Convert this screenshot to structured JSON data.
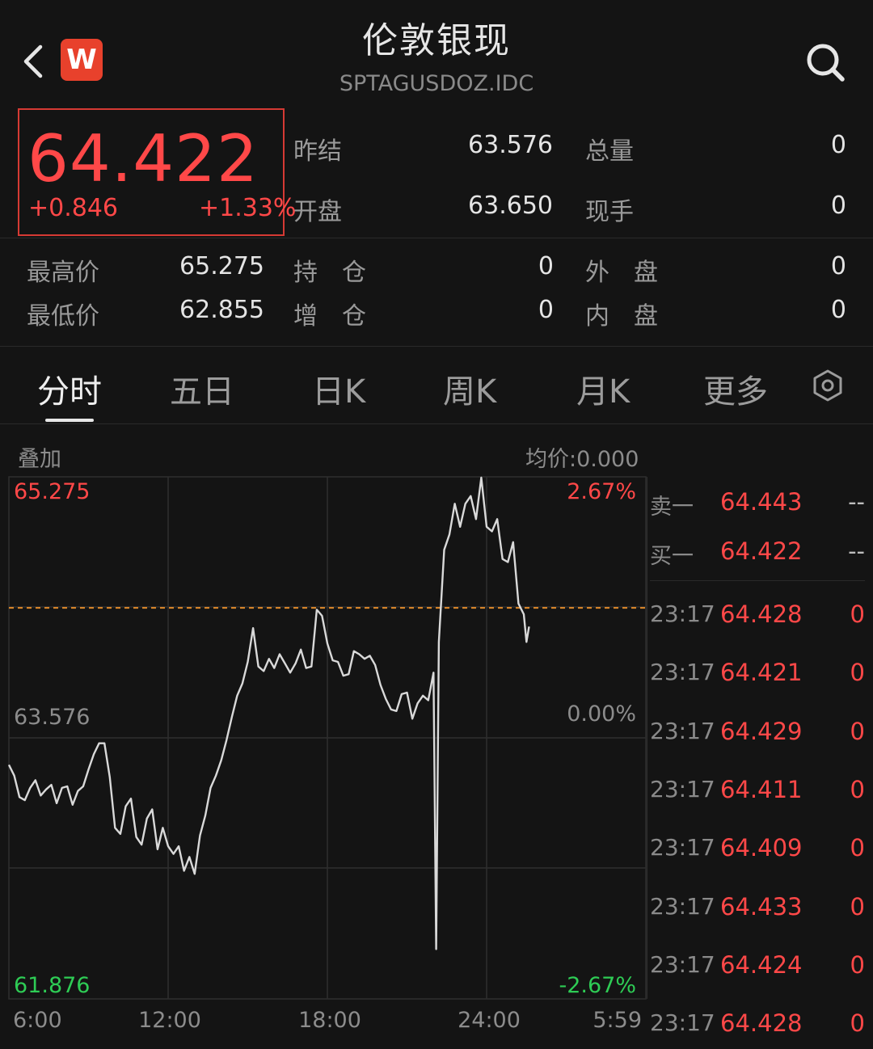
{
  "header": {
    "title": "伦敦银现",
    "code": "SPTAGUSDOZ.IDC",
    "logo_letter": "W"
  },
  "quote": {
    "price": "64.422",
    "change": "+0.846",
    "change_pct": "+1.33%"
  },
  "stats": {
    "prev_settle_label": "昨结",
    "prev_settle": "63.576",
    "total_vol_label": "总量",
    "total_vol": "0",
    "open_label": "开盘",
    "open": "63.650",
    "cur_hand_label": "现手",
    "cur_hand": "0",
    "high_label": "最高价",
    "high": "65.275",
    "hold_label": "持　仓",
    "hold": "0",
    "outer_label": "外　盘",
    "outer": "0",
    "low_label": "最低价",
    "low": "62.855",
    "add_label": "增　仓",
    "add": "0",
    "inner_label": "内　盘",
    "inner": "0"
  },
  "tabs": [
    {
      "label": "分时",
      "active": true
    },
    {
      "label": "五日",
      "active": false
    },
    {
      "label": "日K",
      "active": false
    },
    {
      "label": "周K",
      "active": false
    },
    {
      "label": "月K",
      "active": false
    },
    {
      "label": "更多",
      "active": false
    }
  ],
  "chart_header": {
    "overlay_label": "叠加",
    "avg_price_label": "均价:0.000"
  },
  "chart_data": {
    "type": "line",
    "ylim": [
      61.876,
      65.275
    ],
    "y_left_labels": [
      "65.275",
      "63.576",
      "61.876"
    ],
    "y_right_labels": [
      "2.67%",
      "0.00%",
      "-2.67%"
    ],
    "x_labels": [
      "6:00",
      "12:00",
      "18:00",
      "24:00",
      "5:59"
    ],
    "reference_value": 63.576,
    "current_value": 64.422,
    "colors": {
      "line": "#d9d9d9",
      "up": "#ff4848",
      "down": "#2ecc55",
      "reference": "#e08a2a"
    },
    "points": [
      [
        0,
        63.4
      ],
      [
        2,
        63.33
      ],
      [
        4,
        63.19
      ],
      [
        6,
        63.17
      ],
      [
        8,
        63.25
      ],
      [
        10,
        63.3
      ],
      [
        12,
        63.2
      ],
      [
        14,
        63.24
      ],
      [
        16,
        63.27
      ],
      [
        18,
        63.15
      ],
      [
        20,
        63.25
      ],
      [
        22,
        63.26
      ],
      [
        24,
        63.14
      ],
      [
        26,
        63.23
      ],
      [
        28,
        63.26
      ],
      [
        30,
        63.37
      ],
      [
        32,
        63.47
      ],
      [
        34,
        63.54
      ],
      [
        36,
        63.54
      ],
      [
        38,
        63.32
      ],
      [
        40,
        62.99
      ],
      [
        42,
        62.95
      ],
      [
        44,
        63.13
      ],
      [
        46,
        63.18
      ],
      [
        48,
        62.93
      ],
      [
        50,
        62.88
      ],
      [
        52,
        63.05
      ],
      [
        54,
        63.11
      ],
      [
        56,
        62.85
      ],
      [
        58,
        62.99
      ],
      [
        60,
        62.87
      ],
      [
        62,
        62.82
      ],
      [
        64,
        62.87
      ],
      [
        66,
        62.71
      ],
      [
        68,
        62.8
      ],
      [
        70,
        62.69
      ],
      [
        72,
        62.94
      ],
      [
        74,
        63.07
      ],
      [
        76,
        63.25
      ],
      [
        78,
        63.33
      ],
      [
        80,
        63.43
      ],
      [
        82,
        63.56
      ],
      [
        84,
        63.71
      ],
      [
        86,
        63.85
      ],
      [
        88,
        63.93
      ],
      [
        90,
        64.07
      ],
      [
        92,
        64.29
      ],
      [
        94,
        64.04
      ],
      [
        96,
        64.01
      ],
      [
        98,
        64.09
      ],
      [
        100,
        64.03
      ],
      [
        102,
        64.12
      ],
      [
        104,
        64.06
      ],
      [
        106,
        64.0
      ],
      [
        108,
        64.06
      ],
      [
        110,
        64.15
      ],
      [
        112,
        64.03
      ],
      [
        114,
        64.04
      ],
      [
        116,
        64.41
      ],
      [
        118,
        64.37
      ],
      [
        120,
        64.19
      ],
      [
        122,
        64.08
      ],
      [
        124,
        64.07
      ],
      [
        126,
        63.98
      ],
      [
        128,
        63.99
      ],
      [
        130,
        64.14
      ],
      [
        132,
        64.12
      ],
      [
        134,
        64.09
      ],
      [
        136,
        64.11
      ],
      [
        138,
        64.05
      ],
      [
        140,
        63.92
      ],
      [
        142,
        63.83
      ],
      [
        144,
        63.76
      ],
      [
        146,
        63.75
      ],
      [
        148,
        63.86
      ],
      [
        150,
        63.87
      ],
      [
        152,
        63.7
      ],
      [
        154,
        63.8
      ],
      [
        156,
        63.85
      ],
      [
        158,
        63.82
      ],
      [
        160,
        64.0
      ],
      [
        161,
        62.2
      ],
      [
        162,
        64.2
      ],
      [
        164,
        64.8
      ],
      [
        166,
        64.9
      ],
      [
        168,
        65.1
      ],
      [
        170,
        64.95
      ],
      [
        172,
        65.1
      ],
      [
        174,
        65.15
      ],
      [
        176,
        65.0
      ],
      [
        178,
        65.27
      ],
      [
        180,
        64.95
      ],
      [
        182,
        64.92
      ],
      [
        184,
        65.0
      ],
      [
        186,
        64.74
      ],
      [
        188,
        64.72
      ],
      [
        190,
        64.85
      ],
      [
        192,
        64.45
      ],
      [
        194,
        64.38
      ],
      [
        195,
        64.2
      ],
      [
        196,
        64.3
      ]
    ],
    "x_range": [
      0,
      240
    ]
  },
  "order_book": {
    "sell1_label": "卖一",
    "sell1_price": "64.443",
    "sell1_vol": "--",
    "buy1_label": "买一",
    "buy1_price": "64.422",
    "buy1_vol": "--",
    "ticks": [
      {
        "time": "23:17",
        "price": "64.428",
        "vol": "0"
      },
      {
        "time": "23:17",
        "price": "64.421",
        "vol": "0"
      },
      {
        "time": "23:17",
        "price": "64.429",
        "vol": "0"
      },
      {
        "time": "23:17",
        "price": "64.411",
        "vol": "0"
      },
      {
        "time": "23:17",
        "price": "64.409",
        "vol": "0"
      },
      {
        "time": "23:17",
        "price": "64.433",
        "vol": "0"
      },
      {
        "time": "23:17",
        "price": "64.424",
        "vol": "0"
      },
      {
        "time": "23:17",
        "price": "64.428",
        "vol": "0"
      }
    ]
  }
}
